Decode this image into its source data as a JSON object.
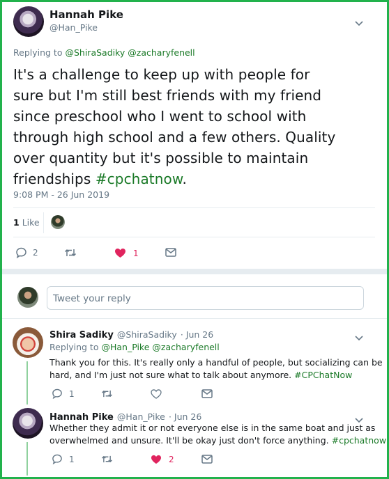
{
  "main_tweet": {
    "author_name": "Hannah Pike",
    "author_handle": "@Han_Pike",
    "replying_prefix": "Replying to",
    "replying_handles": "@ShiraSadiky @zacharyfenell",
    "text_lines": [
      "It's a challenge to keep up with people for",
      "sure but I'm still best friends with my friend",
      "since preschool who I went to school with",
      "through high school and a few others. Quality",
      "over quantity but it's possible to maintain"
    ],
    "text_last_prefix": "friendships ",
    "hashtag": "#cpchatnow",
    "text_last_suffix": ".",
    "timestamp": "9:08 PM - 26 Jun 2019",
    "likes_count": "1",
    "likes_label": "Like",
    "reply_count": "2",
    "heart_count": "1"
  },
  "reply_box": {
    "placeholder": "Tweet your reply"
  },
  "replies": [
    {
      "author_name": "Shira Sadiky",
      "author_handle": "@ShiraSadiky",
      "date": "· Jun 26",
      "replying_prefix": "Replying to",
      "replying_handles": "@Han_Pike @zacharyfenell",
      "line1": "Thank you for this. It's really only a handful of people, but socializing can be",
      "line2_prefix": "hard, and I'm just not sure what to talk about anymore. ",
      "hashtag": "#CPChatNow",
      "reply_count": "1"
    },
    {
      "author_name": "Hannah Pike",
      "author_handle": "@Han_Pike",
      "date": "· Jun 26",
      "line1": "Whether they admit it or not everyone else is in the same boat and just as",
      "line2_prefix": "overwhelmed and unsure. It'll be okay just don't force anything. ",
      "hashtag": "#cpchatnow",
      "reply_count": "1",
      "heart_count": "2"
    }
  ],
  "colors": {
    "frame_border": "#22b24c",
    "link_green": "#1b7a28",
    "heart_red": "#e0245e",
    "thread_line": "#8fd19e",
    "muted_text": "#657786"
  },
  "icons": [
    "chevron-down-icon",
    "reply-icon",
    "retweet-icon",
    "heart-icon",
    "message-icon"
  ]
}
